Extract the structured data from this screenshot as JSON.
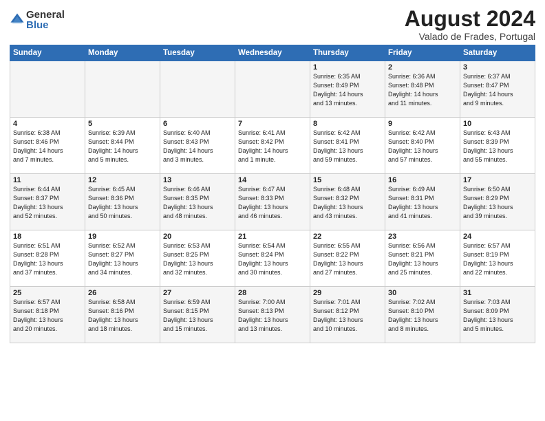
{
  "logo": {
    "general": "General",
    "blue": "Blue"
  },
  "title": "August 2024",
  "location": "Valado de Frades, Portugal",
  "headers": [
    "Sunday",
    "Monday",
    "Tuesday",
    "Wednesday",
    "Thursday",
    "Friday",
    "Saturday"
  ],
  "weeks": [
    [
      {
        "day": "",
        "info": ""
      },
      {
        "day": "",
        "info": ""
      },
      {
        "day": "",
        "info": ""
      },
      {
        "day": "",
        "info": ""
      },
      {
        "day": "1",
        "info": "Sunrise: 6:35 AM\nSunset: 8:49 PM\nDaylight: 14 hours\nand 13 minutes."
      },
      {
        "day": "2",
        "info": "Sunrise: 6:36 AM\nSunset: 8:48 PM\nDaylight: 14 hours\nand 11 minutes."
      },
      {
        "day": "3",
        "info": "Sunrise: 6:37 AM\nSunset: 8:47 PM\nDaylight: 14 hours\nand 9 minutes."
      }
    ],
    [
      {
        "day": "4",
        "info": "Sunrise: 6:38 AM\nSunset: 8:46 PM\nDaylight: 14 hours\nand 7 minutes."
      },
      {
        "day": "5",
        "info": "Sunrise: 6:39 AM\nSunset: 8:44 PM\nDaylight: 14 hours\nand 5 minutes."
      },
      {
        "day": "6",
        "info": "Sunrise: 6:40 AM\nSunset: 8:43 PM\nDaylight: 14 hours\nand 3 minutes."
      },
      {
        "day": "7",
        "info": "Sunrise: 6:41 AM\nSunset: 8:42 PM\nDaylight: 14 hours\nand 1 minute."
      },
      {
        "day": "8",
        "info": "Sunrise: 6:42 AM\nSunset: 8:41 PM\nDaylight: 13 hours\nand 59 minutes."
      },
      {
        "day": "9",
        "info": "Sunrise: 6:42 AM\nSunset: 8:40 PM\nDaylight: 13 hours\nand 57 minutes."
      },
      {
        "day": "10",
        "info": "Sunrise: 6:43 AM\nSunset: 8:39 PM\nDaylight: 13 hours\nand 55 minutes."
      }
    ],
    [
      {
        "day": "11",
        "info": "Sunrise: 6:44 AM\nSunset: 8:37 PM\nDaylight: 13 hours\nand 52 minutes."
      },
      {
        "day": "12",
        "info": "Sunrise: 6:45 AM\nSunset: 8:36 PM\nDaylight: 13 hours\nand 50 minutes."
      },
      {
        "day": "13",
        "info": "Sunrise: 6:46 AM\nSunset: 8:35 PM\nDaylight: 13 hours\nand 48 minutes."
      },
      {
        "day": "14",
        "info": "Sunrise: 6:47 AM\nSunset: 8:33 PM\nDaylight: 13 hours\nand 46 minutes."
      },
      {
        "day": "15",
        "info": "Sunrise: 6:48 AM\nSunset: 8:32 PM\nDaylight: 13 hours\nand 43 minutes."
      },
      {
        "day": "16",
        "info": "Sunrise: 6:49 AM\nSunset: 8:31 PM\nDaylight: 13 hours\nand 41 minutes."
      },
      {
        "day": "17",
        "info": "Sunrise: 6:50 AM\nSunset: 8:29 PM\nDaylight: 13 hours\nand 39 minutes."
      }
    ],
    [
      {
        "day": "18",
        "info": "Sunrise: 6:51 AM\nSunset: 8:28 PM\nDaylight: 13 hours\nand 37 minutes."
      },
      {
        "day": "19",
        "info": "Sunrise: 6:52 AM\nSunset: 8:27 PM\nDaylight: 13 hours\nand 34 minutes."
      },
      {
        "day": "20",
        "info": "Sunrise: 6:53 AM\nSunset: 8:25 PM\nDaylight: 13 hours\nand 32 minutes."
      },
      {
        "day": "21",
        "info": "Sunrise: 6:54 AM\nSunset: 8:24 PM\nDaylight: 13 hours\nand 30 minutes."
      },
      {
        "day": "22",
        "info": "Sunrise: 6:55 AM\nSunset: 8:22 PM\nDaylight: 13 hours\nand 27 minutes."
      },
      {
        "day": "23",
        "info": "Sunrise: 6:56 AM\nSunset: 8:21 PM\nDaylight: 13 hours\nand 25 minutes."
      },
      {
        "day": "24",
        "info": "Sunrise: 6:57 AM\nSunset: 8:19 PM\nDaylight: 13 hours\nand 22 minutes."
      }
    ],
    [
      {
        "day": "25",
        "info": "Sunrise: 6:57 AM\nSunset: 8:18 PM\nDaylight: 13 hours\nand 20 minutes."
      },
      {
        "day": "26",
        "info": "Sunrise: 6:58 AM\nSunset: 8:16 PM\nDaylight: 13 hours\nand 18 minutes."
      },
      {
        "day": "27",
        "info": "Sunrise: 6:59 AM\nSunset: 8:15 PM\nDaylight: 13 hours\nand 15 minutes."
      },
      {
        "day": "28",
        "info": "Sunrise: 7:00 AM\nSunset: 8:13 PM\nDaylight: 13 hours\nand 13 minutes."
      },
      {
        "day": "29",
        "info": "Sunrise: 7:01 AM\nSunset: 8:12 PM\nDaylight: 13 hours\nand 10 minutes."
      },
      {
        "day": "30",
        "info": "Sunrise: 7:02 AM\nSunset: 8:10 PM\nDaylight: 13 hours\nand 8 minutes."
      },
      {
        "day": "31",
        "info": "Sunrise: 7:03 AM\nSunset: 8:09 PM\nDaylight: 13 hours\nand 5 minutes."
      }
    ]
  ]
}
